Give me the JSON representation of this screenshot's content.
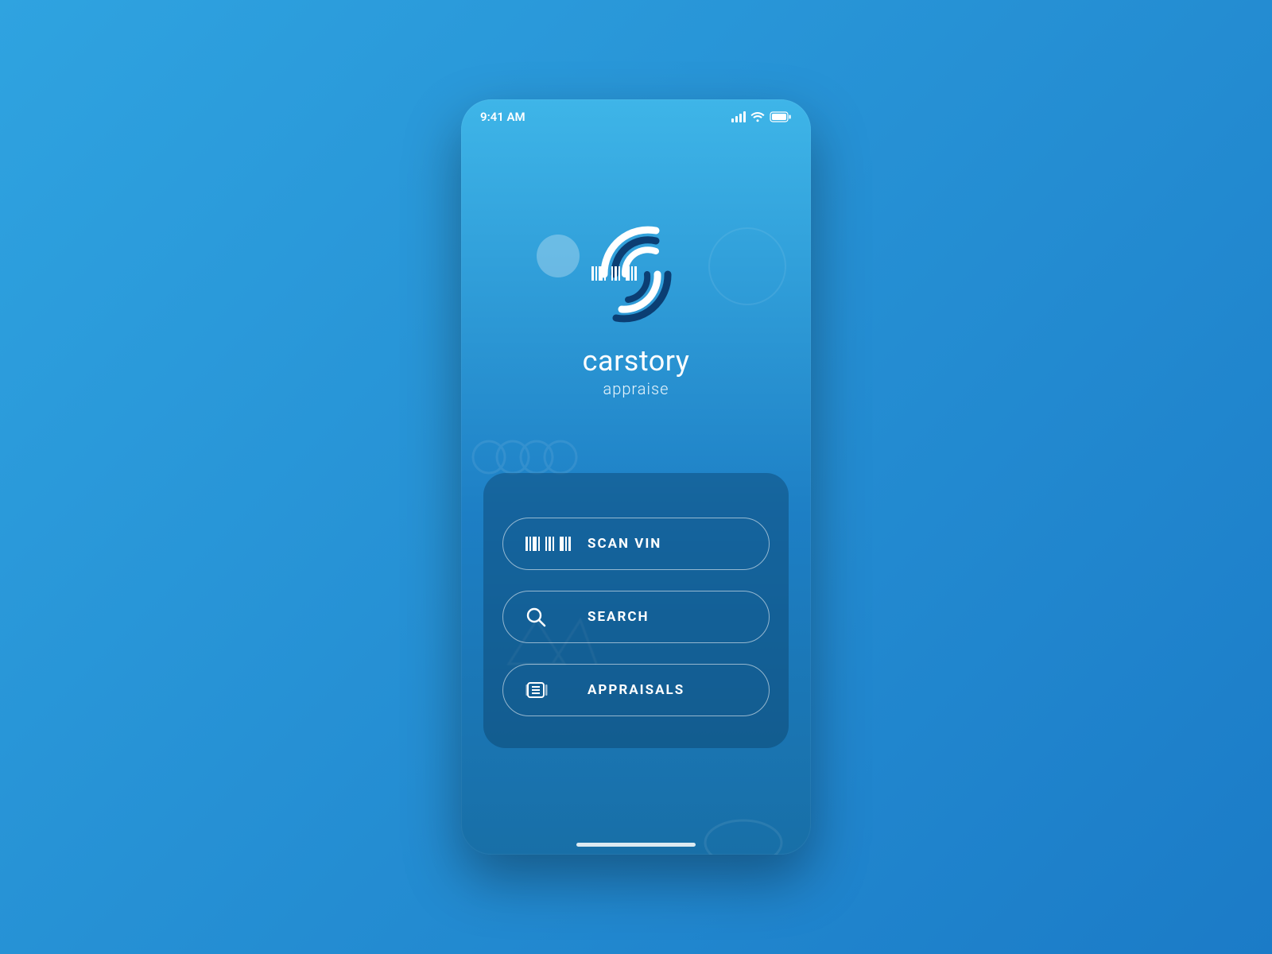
{
  "status": {
    "time": "9:41 AM"
  },
  "brand": {
    "name": "carstory",
    "sub": "appraise"
  },
  "actions": {
    "scan": {
      "label": "SCAN VIN"
    },
    "search": {
      "label": "SEARCH"
    },
    "appraisals": {
      "label": "APPRAISALS"
    }
  }
}
